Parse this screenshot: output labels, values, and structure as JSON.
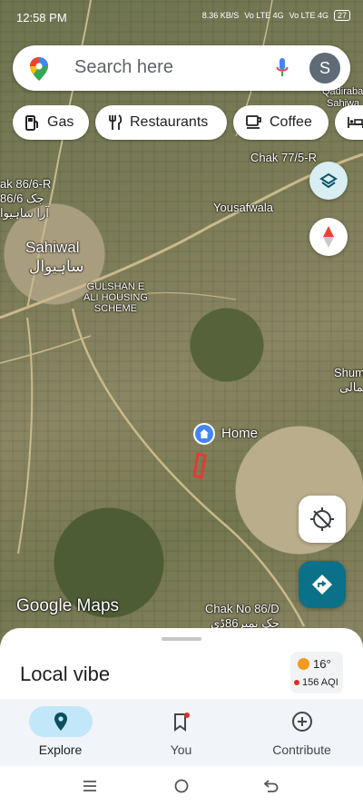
{
  "status_bar": {
    "time": "12:58 PM",
    "net_speed": "8.36 KB/S",
    "net1": "Vo LTE 4G",
    "net2": "Vo LTE 4G",
    "battery": "27"
  },
  "search": {
    "placeholder": "Search here",
    "avatar_letter": "S"
  },
  "chips": [
    {
      "label": "Gas",
      "icon": "gas-station-icon"
    },
    {
      "label": "Restaurants",
      "icon": "restaurant-icon"
    },
    {
      "label": "Coffee",
      "icon": "coffee-icon"
    },
    {
      "label": "",
      "icon": "hotel-icon"
    }
  ],
  "map": {
    "labels": {
      "qadirabad": "Qadirabad",
      "sahiwal_top": "Sahiwa",
      "chak_77": "Chak 77/5-R",
      "chak_86_6": "ak 86/6-R",
      "chak_86_6_urdu": "جک 86/6",
      "urdu_left": "آرا ساہیوا",
      "yousafwala": "Yousafwala",
      "sahiwal": "Sahiwal",
      "sahiwal_urdu": "ساہیوال",
      "gulshan": "GULSHAN E\nALI HOUSING\nSCHEME",
      "shum": "Shum",
      "shum_urdu": "شمالی",
      "home": "Home",
      "chak_86_d": "Chak No 86/D",
      "chak_86_d_urdu": "جک نمبر86ڈی",
      "google_maps": "Google Maps"
    }
  },
  "sheet": {
    "title": "Local vibe",
    "temperature": "16°",
    "aqi": "156 AQI"
  },
  "bottom_nav": [
    {
      "label": "Explore",
      "active": true
    },
    {
      "label": "You",
      "active": false
    },
    {
      "label": "Contribute",
      "active": false
    }
  ],
  "colors": {
    "accent_teal": "#0b7188",
    "explore_active_bg": "#c2e7f9",
    "home_pin": "#4285f4",
    "route_red": "#e53935"
  }
}
